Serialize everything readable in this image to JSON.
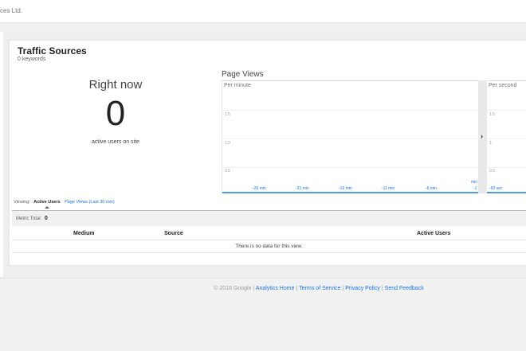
{
  "header": {
    "breadcrumb": "ces Ltd."
  },
  "report": {
    "title": "Traffic Sources",
    "subtitle": "0 keywords"
  },
  "right_now": {
    "label": "Right now",
    "value": "0",
    "caption": "active users on site"
  },
  "pageviews": {
    "title": "Page Views",
    "per_minute_label": "Per minute",
    "per_second_label": "Per second",
    "y_ticks_minute": [
      "1.5",
      "1.0",
      "0.5"
    ],
    "y_ticks_second": [
      "1.5",
      "1.",
      "0.5"
    ],
    "x_ticks_minute": [
      "-26 min",
      "-21 min",
      "-16 min",
      "-11 min",
      "-6 min"
    ],
    "x_last_tick_top": "min",
    "x_last_tick_bottom": "-1",
    "x_ticks_second": [
      "-60 sec"
    ],
    "accent_color": "#4a9ee0"
  },
  "viewing": {
    "label": "Viewing:",
    "active_tab": "Active Users",
    "other_tab": "Page Views (Last 30 min)"
  },
  "metric": {
    "label": "Metric Total:",
    "value": "0"
  },
  "table": {
    "columns": [
      "Medium",
      "Source",
      "Active Users"
    ],
    "empty_message": "There is no data for this view."
  },
  "footer": {
    "copyright": "© 2018 Google |",
    "links": [
      "Analytics Home",
      "Terms of Service",
      "Privacy Policy",
      "Send Feedback"
    ]
  }
}
